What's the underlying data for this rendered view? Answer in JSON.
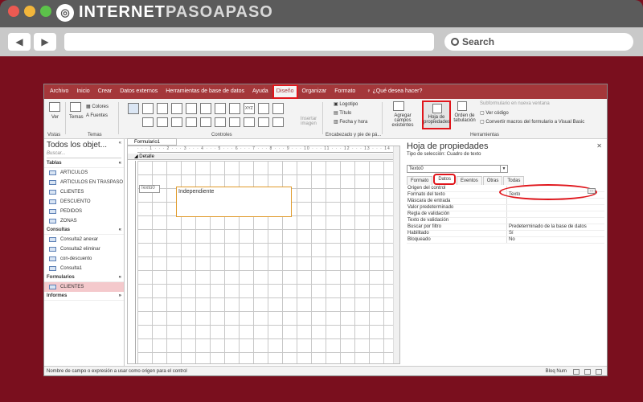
{
  "browser": {
    "brand_part1": "INTERNET",
    "brand_part2": "PASOAPASO",
    "search_label": "Search"
  },
  "menubar": {
    "items": [
      "Archivo",
      "Inicio",
      "Crear",
      "Datos externos",
      "Herramientas de base de datos",
      "Ayuda",
      "Diseño",
      "Organizar",
      "Formato"
    ],
    "tell_me": "¿Qué desea hacer?"
  },
  "ribbon": {
    "ver": "Ver",
    "vistas": "Vistas",
    "temas": "Temas",
    "temas_group": "Temas",
    "colores": "Colores",
    "fuentes": "Fuentes",
    "controles": "Controles",
    "insertar_imagen": "Insertar imagen",
    "logotipo": "Logotipo",
    "titulo": "Título",
    "fecha_hora": "Fecha y hora",
    "encabezado": "Encabezado y pie de pá...",
    "agregar_campos": "Agregar campos existentes",
    "hoja_prop": "Hoja de propiedades",
    "orden_tab": "Orden de tabulación",
    "subformulario": "Subformulario en nueva ventana",
    "ver_codigo": "Ver código",
    "convertir_macros": "Convertir macros del formulario a Visual Basic",
    "herramientas": "Herramientas",
    "xyz": "XYZ"
  },
  "navpane": {
    "title": "Todos los objet...",
    "search_placeholder": "Buscar...",
    "groups": {
      "tablas": "Tablas",
      "consultas": "Consultas",
      "formularios": "Formularios",
      "informes": "Informes"
    },
    "tablas": [
      "ARTICULOS",
      "ARTICULOS EN TRASPASO",
      "CLIENTES",
      "DESCUENTO",
      "PEDIDOS",
      "ZONAS"
    ],
    "consultas": [
      "Consulta2 anexar",
      "Consulta2 eliminar",
      "con-descuento",
      "Consulta1"
    ],
    "formularios": [
      "CLIENTES"
    ]
  },
  "designer": {
    "tab": "Formulario1",
    "detalle": "Detalle",
    "label_texto": "Texto0",
    "textbox": "Independiente"
  },
  "props": {
    "title": "Hoja de propiedades",
    "selection_type": "Tipo de selección:  Cuadro de texto",
    "selected": "Texto0",
    "tabs": [
      "Formato",
      "Datos",
      "Eventos",
      "Otras",
      "Todas"
    ],
    "rows": [
      {
        "k": "Origen del control",
        "v": ""
      },
      {
        "k": "Formato del texto",
        "v": "Texto"
      },
      {
        "k": "Máscara de entrada",
        "v": ""
      },
      {
        "k": "Valor predeterminado",
        "v": ""
      },
      {
        "k": "Regla de validación",
        "v": ""
      },
      {
        "k": "Texto de validación",
        "v": ""
      },
      {
        "k": "Buscar por filtro",
        "v": "Predeterminado de la base de datos"
      },
      {
        "k": "Habilitado",
        "v": "Sí"
      },
      {
        "k": "Bloqueado",
        "v": "No"
      }
    ]
  },
  "statusbar": {
    "message": "Nombre de campo o expresión a usar como origen para el control",
    "mode": "Bloq Num"
  },
  "colors": {
    "background": "#7a0f1e",
    "accent": "#a4373a",
    "highlight": "#e0151b"
  }
}
